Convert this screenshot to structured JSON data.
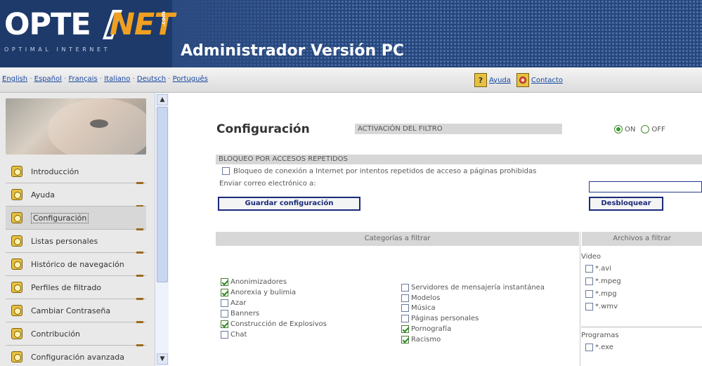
{
  "header": {
    "logo_opte": "OPTE",
    "logo_net": "NET",
    "logo_com": ".com",
    "logo_tagline": "OPTIMAL INTERNET",
    "title": "Administrador Versión PC"
  },
  "languages": [
    "English",
    "Español",
    "Français",
    "Italiano",
    "Deutsch",
    "Português"
  ],
  "help": {
    "ayuda_icon": "?",
    "ayuda_label": "Ayuda",
    "contacto_label": "Contacto"
  },
  "sidebar": {
    "items": [
      {
        "label": "Introducción"
      },
      {
        "label": "Ayuda"
      },
      {
        "label": "Configuración"
      },
      {
        "label": "Listas personales"
      },
      {
        "label": "Histórico de navegación"
      },
      {
        "label": "Perfiles de filtrado"
      },
      {
        "label": "Cambiar Contraseña"
      },
      {
        "label": "Contribución"
      },
      {
        "label": "Configuración avanzada"
      }
    ],
    "active_index": 2
  },
  "main": {
    "title": "Configuración",
    "filter_activation_label": "ACTIVACIÓN DEL FILTRO",
    "on_label": "ON",
    "off_label": "OFF",
    "filter_state": "ON",
    "block_header": "BLOQUEO POR ACCESOS REPETIDOS",
    "block_checkbox_label": "Bloqueo de conexión a Internet por intentos repetidos de acceso a páginas prohibidas",
    "email_label": "Enviar correo electrónico a:",
    "email_value": "",
    "save_button": "Guardar configuración",
    "unblock_button": "Desbloquear",
    "categories_header": "Categorías a filtrar",
    "files_header": "Archivos a filtrar",
    "categories_left": [
      {
        "label": "Anonimizadores",
        "checked": true
      },
      {
        "label": "Anorexia y bulimia",
        "checked": true
      },
      {
        "label": "Azar",
        "checked": false
      },
      {
        "label": "Banners",
        "checked": false
      },
      {
        "label": "Construcción de Explosivos",
        "checked": true
      },
      {
        "label": "Chat",
        "checked": false
      }
    ],
    "categories_right": [
      {
        "label": "Servidores de mensajería instantánea",
        "checked": false
      },
      {
        "label": "Modelos",
        "checked": false
      },
      {
        "label": "Música",
        "checked": false
      },
      {
        "label": "Páginas personales",
        "checked": false
      },
      {
        "label": "Pornografía",
        "checked": true
      },
      {
        "label": "Racismo",
        "checked": true
      }
    ],
    "files_video_title": "Video",
    "files_video": [
      {
        "label": "*.avi",
        "checked": false
      },
      {
        "label": "*.mpeg",
        "checked": false
      },
      {
        "label": "*.mpg",
        "checked": false
      },
      {
        "label": "*.wmv",
        "checked": false
      }
    ],
    "files_programs_title": "Programas",
    "files_programs": [
      {
        "label": "*.exe",
        "checked": false
      }
    ]
  },
  "colors": {
    "header_blue": "#2a4a80",
    "brand_orange": "#f0a020",
    "link_blue": "#1a4aa0",
    "button_border": "#1a2a7a",
    "check_green": "#2a8a20"
  },
  "icons": {
    "menu": "folder-icon",
    "help": "help-icon",
    "contact": "contact-icon",
    "scroll_up": "chevron-up-icon",
    "scroll_down": "chevron-down-icon"
  }
}
